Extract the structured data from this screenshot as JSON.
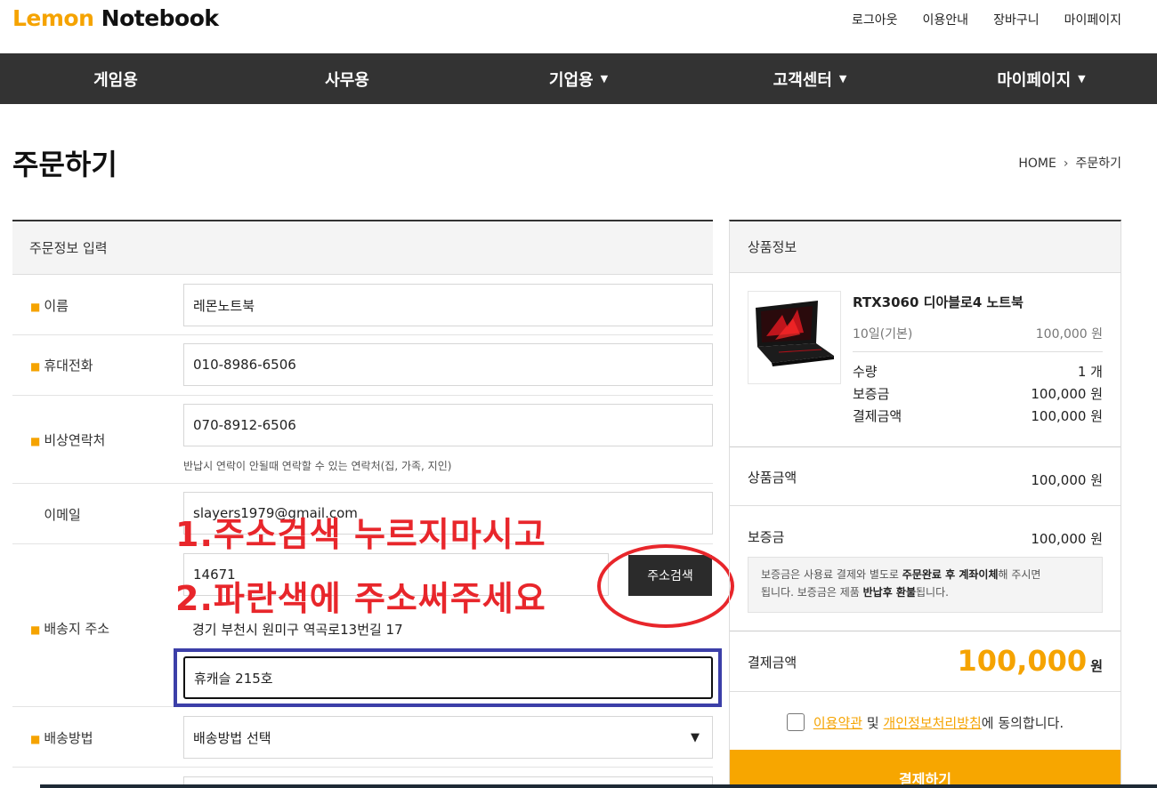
{
  "logo": {
    "part1": "Lemon",
    "part2": "Notebook"
  },
  "top_links": [
    "로그아웃",
    "이용안내",
    "장바구니",
    "마이페이지"
  ],
  "nav": [
    {
      "label": "게임용",
      "dropdown": false
    },
    {
      "label": "사무용",
      "dropdown": false
    },
    {
      "label": "기업용",
      "dropdown": true
    },
    {
      "label": "고객센터",
      "dropdown": true
    },
    {
      "label": "마이페이지",
      "dropdown": true
    }
  ],
  "page_title": "주문하기",
  "breadcrumb": {
    "home": "HOME",
    "current": "주문하기"
  },
  "form": {
    "heading": "주문정보 입력",
    "name_label": "이름",
    "name_value": "레몬노트북",
    "phone_label": "휴대전화",
    "phone_value": "010-8986-6506",
    "emergency_label": "비상연락처",
    "emergency_value": "070-8912-6506",
    "emergency_hint": "반납시 연락이 안될때 연락할 수 있는 연락처(집, 가족, 지인)",
    "email_label": "이메일",
    "email_value": "slayers1979@gmail.com",
    "address_label": "배송지 주소",
    "zip_value": "14671",
    "address_search_button": "주소검색",
    "address_value": "경기 부천시 원미구 역곡로13번길 17",
    "address_detail_value": "휴캐슬 215호",
    "shipping_label": "배송방법",
    "shipping_value": "배송방법 선택"
  },
  "annotations": {
    "note1": "1.주소검색 누르지마시고",
    "note2": "2.파란색에 주소써주세요",
    "red_color": "#e8262b",
    "blue_color": "#3c3fa8"
  },
  "product": {
    "heading": "상품정보",
    "name": "RTX3060 디아블로4 노트북",
    "plan": "10일(기본)",
    "plan_price": "100,000 원",
    "qty_label": "수량",
    "qty_value": "1 개",
    "deposit_label": "보증금",
    "deposit_value": "100,000 원",
    "pay_label": "결제금액",
    "pay_value": "100,000 원"
  },
  "summary": {
    "product_amount_label": "상품금액",
    "product_amount_value": "100,000 원",
    "deposit_label": "보증금",
    "deposit_value": "100,000 원",
    "deposit_note_1": "보증금은 사용료 결제와 별도로 ",
    "deposit_note_bold_1": "주문완료 후 계좌이체",
    "deposit_note_2": "해 주시면",
    "deposit_note_3": "됩니다. 보증금은 제품 ",
    "deposit_note_bold_2": "반납후 환불",
    "deposit_note_4": "됩니다.",
    "total_label": "결제금액",
    "total_value": "100,000",
    "total_unit": "원",
    "agree_terms": "이용약관",
    "agree_and": " 및 ",
    "agree_privacy": "개인정보처리방침",
    "agree_suffix": "에 동의합니다.",
    "pay_button": "결제하기"
  },
  "colors": {
    "accent": "#f5a300",
    "nav_bg": "#333333"
  }
}
